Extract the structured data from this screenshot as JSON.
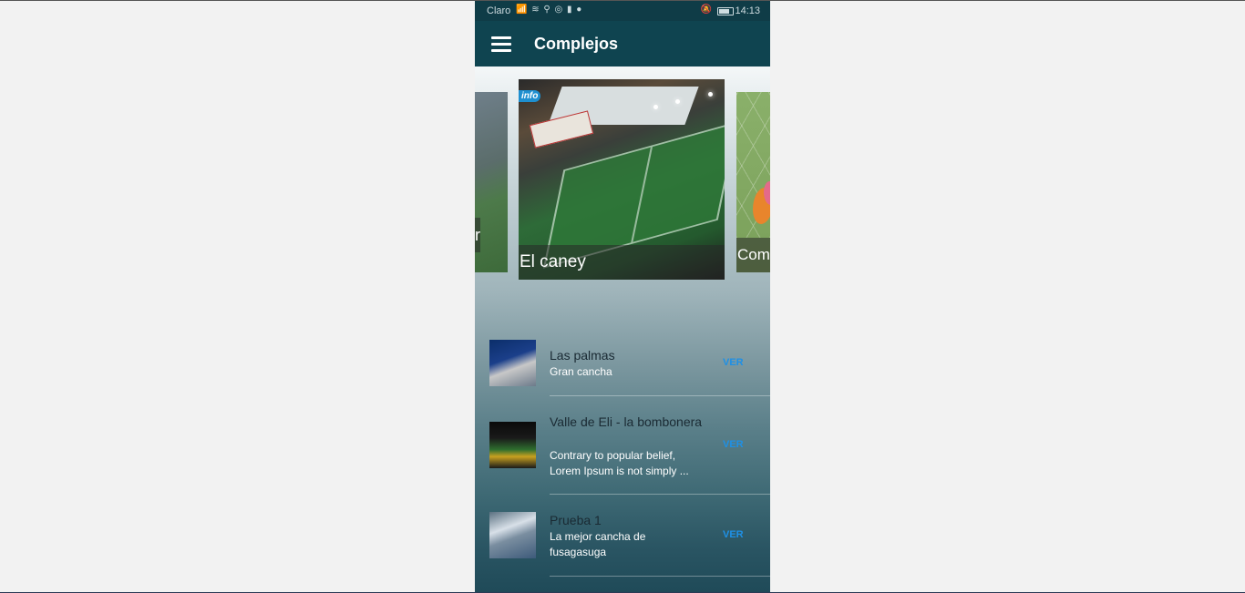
{
  "status_bar": {
    "carrier": "Claro",
    "left_icons": "📶 ≋ ⚲ ◎ ▮ ●",
    "right_icon_alarm": "🔕",
    "time": "14:13"
  },
  "app_bar": {
    "title": "Complejos",
    "menu_icon": "menu-icon"
  },
  "carousel": {
    "left_card": {
      "label": "r"
    },
    "center_card": {
      "label": "El caney",
      "badge": "info"
    },
    "right_card": {
      "label": "Com"
    }
  },
  "list": [
    {
      "title": "Las palmas",
      "subtitle": "Gran cancha",
      "action": "VER"
    },
    {
      "title": "Valle de Eli - la bombonera",
      "subtitle": "Contrary to popular belief, Lorem Ipsum is not simply ...",
      "action": "VER"
    },
    {
      "title": "Prueba 1",
      "subtitle": "La mejor cancha de fusagasuga",
      "action": "VER"
    }
  ],
  "colors": {
    "app_bar": "#0f4450",
    "status_bar": "#0f3c47",
    "action_link": "#1e90e6",
    "page_background": "#f2f2f2"
  }
}
